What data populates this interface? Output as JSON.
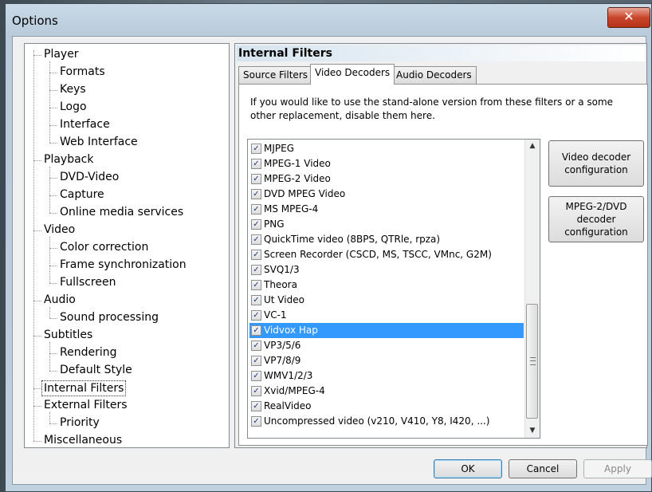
{
  "window": {
    "title": "Options",
    "close_label": "✕"
  },
  "tree": [
    {
      "label": "Player",
      "level": 0
    },
    {
      "label": "Formats",
      "level": 1
    },
    {
      "label": "Keys",
      "level": 1
    },
    {
      "label": "Logo",
      "level": 1
    },
    {
      "label": "Interface",
      "level": 1
    },
    {
      "label": "Web Interface",
      "level": 1
    },
    {
      "label": "Playback",
      "level": 0
    },
    {
      "label": "DVD-Video",
      "level": 1
    },
    {
      "label": "Capture",
      "level": 1
    },
    {
      "label": "Online media services",
      "level": 1
    },
    {
      "label": "Video",
      "level": 0
    },
    {
      "label": "Color correction",
      "level": 1
    },
    {
      "label": "Frame synchronization",
      "level": 1
    },
    {
      "label": "Fullscreen",
      "level": 1
    },
    {
      "label": "Audio",
      "level": 0
    },
    {
      "label": "Sound processing",
      "level": 1
    },
    {
      "label": "Subtitles",
      "level": 0
    },
    {
      "label": "Rendering",
      "level": 1
    },
    {
      "label": "Default Style",
      "level": 1
    },
    {
      "label": "Internal Filters",
      "level": 0,
      "selected": true
    },
    {
      "label": "External Filters",
      "level": 0
    },
    {
      "label": "Priority",
      "level": 1
    },
    {
      "label": "Miscellaneous",
      "level": 0
    }
  ],
  "panel": {
    "header": "Internal Filters",
    "tabs": [
      {
        "label": "Source Filters",
        "active": false
      },
      {
        "label": "Video Decoders",
        "active": true
      },
      {
        "label": "Audio Decoders",
        "active": false
      }
    ],
    "description": "If you would like to use the stand-alone version from these filters or a some other replacement, disable them here.",
    "filters": [
      {
        "label": "MJPEG",
        "checked": true
      },
      {
        "label": "MPEG-1 Video",
        "checked": true
      },
      {
        "label": "MPEG-2 Video",
        "checked": true
      },
      {
        "label": "DVD MPEG Video",
        "checked": true
      },
      {
        "label": "MS MPEG-4",
        "checked": true
      },
      {
        "label": "PNG",
        "checked": true
      },
      {
        "label": "QuickTime video (8BPS, QTRle, rpza)",
        "checked": true
      },
      {
        "label": "Screen Recorder (CSCD, MS, TSCC, VMnc, G2M)",
        "checked": true
      },
      {
        "label": "SVQ1/3",
        "checked": true
      },
      {
        "label": "Theora",
        "checked": true
      },
      {
        "label": "Ut Video",
        "checked": true
      },
      {
        "label": "VC-1",
        "checked": true
      },
      {
        "label": "Vidvox Hap",
        "checked": true,
        "selected": true
      },
      {
        "label": "VP3/5/6",
        "checked": true
      },
      {
        "label": "VP7/8/9",
        "checked": true
      },
      {
        "label": "WMV1/2/3",
        "checked": true
      },
      {
        "label": "Xvid/MPEG-4",
        "checked": true
      },
      {
        "label": "RealVideo",
        "checked": true
      },
      {
        "label": "Uncompressed video (v210, V410, Y8, I420, ...)",
        "checked": true
      }
    ],
    "video_decoder_config": "Video decoder configuration",
    "mpeg2_dvd_config": "MPEG-2/DVD decoder configuration"
  },
  "buttons": {
    "ok": "OK",
    "cancel": "Cancel",
    "apply": "Apply"
  }
}
